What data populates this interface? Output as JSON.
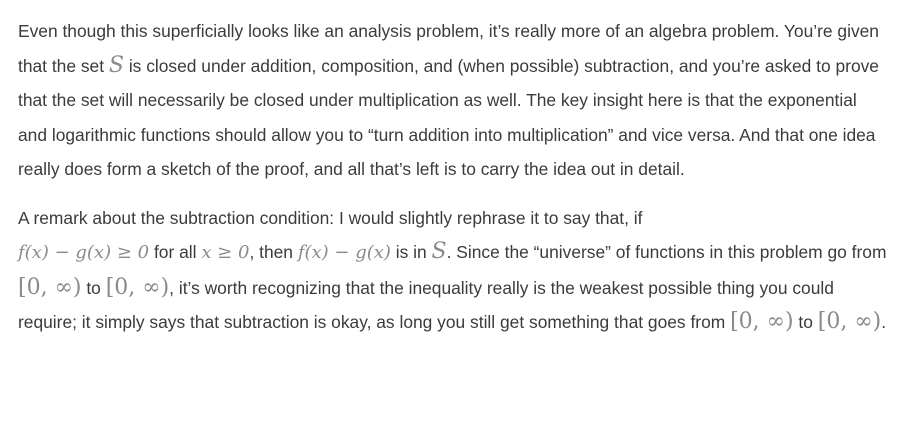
{
  "paragraph1": {
    "text": "Even though this superficially looks like an analysis problem, it’s really more of an algebra problem. You’re given that the set",
    "set_symbol": "S",
    "text2": "is closed under addition, composition, and (when possible) subtraction, and you’re asked to prove that the set will necessarily be closed under multiplication as well. The key insight here is that the exponential and logarithmic functions should allow you to “turn addition into multiplication” and vice versa. And that one idea really does form a sketch of the proof, and all that’s left is to carry the idea out in detail."
  },
  "paragraph2": {
    "t1": "A remark about the subtraction condition: I would slightly rephrase it to say that, if",
    "m1": "f(x) − g(x) ≥ 0",
    "t2": "for all",
    "m2": "x ≥ 0",
    "t3": ", then",
    "m3": "f(x) − g(x)",
    "t4": "is in",
    "m4": "S",
    "t5": ". Since the “universe” of functions in this problem go from",
    "m5": "[0, ∞)",
    "t6": "to",
    "m6": "[0, ∞)",
    "t7": ", it’s worth recognizing that the inequality really is the weakest possible thing you could require; it simply says that subtraction is okay, as long you still get something that goes from",
    "m7": "[0, ∞)",
    "t8": "to",
    "m8": "[0, ∞)",
    "t9": "."
  }
}
